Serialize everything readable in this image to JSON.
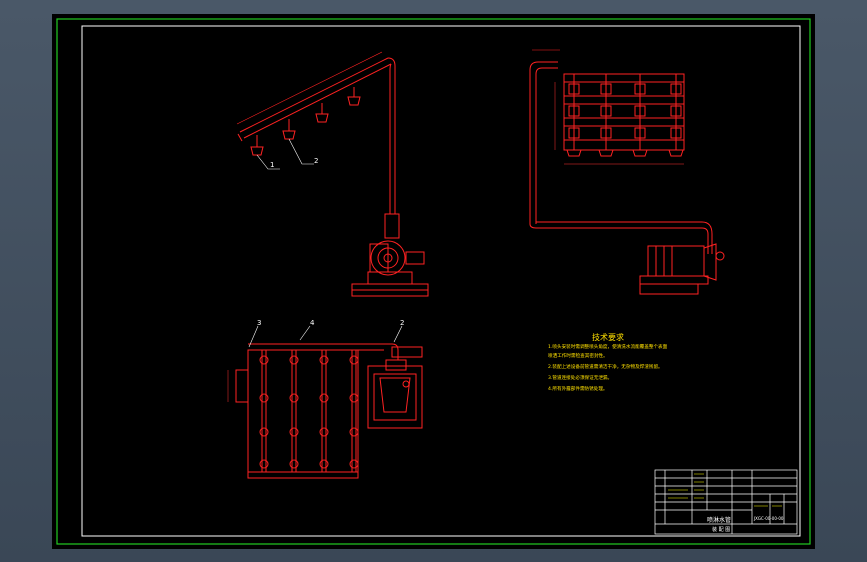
{
  "drawing": {
    "tech_notes": {
      "heading": "技术要求",
      "lines": [
        "1.喷头安装时需调整喷头角度，使清洗水流能覆盖整个表面",
        "  喷洒工作时需检查其密封性。",
        "2.装配上述设备前管道需清洁干净，无杂物及焊渣残留。",
        "3.管道连接处必须保证无泄漏。",
        "4.所有外露部件需防锈处理。"
      ]
    },
    "callouts": {
      "view1": [
        "1",
        "2"
      ],
      "view3": [
        "3",
        "4",
        "2"
      ]
    },
    "title_block": {
      "part_name": "喷淋水管",
      "scale_row": "装 配 图",
      "drawing_no": "JXGC-00-00-00"
    },
    "colors": {
      "outer_border": "#22cc22",
      "frame": "#ffffff",
      "parts": "#ff2222",
      "notes": "#ffe000"
    }
  }
}
